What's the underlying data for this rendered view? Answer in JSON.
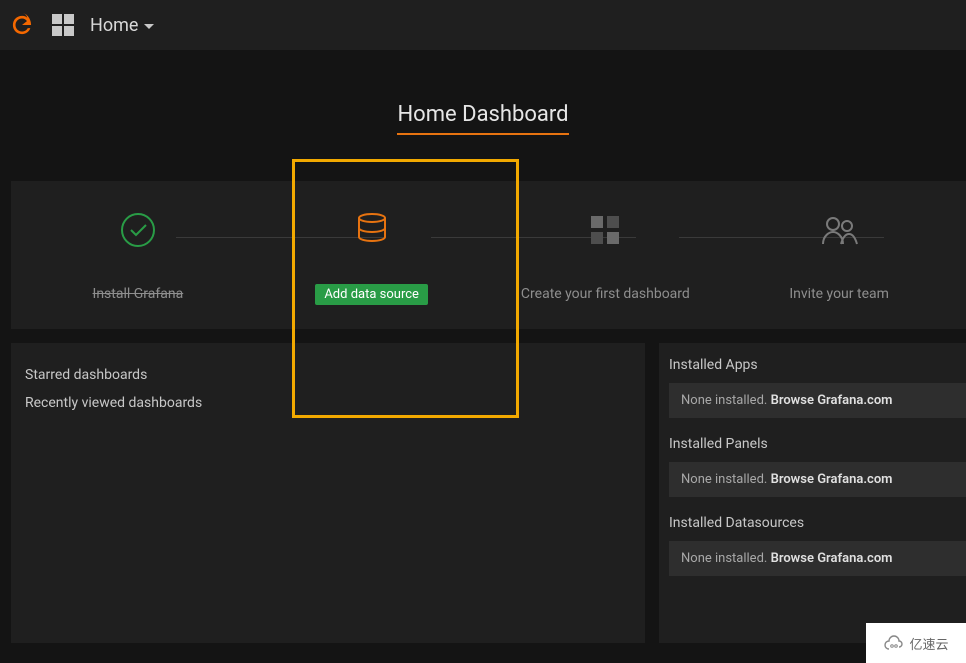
{
  "nav": {
    "breadcrumb": "Home"
  },
  "title": "Home Dashboard",
  "colors": {
    "accent": "#e77310",
    "success": "#299c46"
  },
  "getting_started": {
    "steps": [
      {
        "label": "Install Grafana",
        "state": "done",
        "icon": "check-circle"
      },
      {
        "label": "Add data source",
        "state": "active",
        "icon": "database"
      },
      {
        "label": "Create your first dashboard",
        "state": "pending",
        "icon": "dashboard-grid"
      },
      {
        "label": "Invite your team",
        "state": "pending",
        "icon": "users"
      }
    ]
  },
  "left_panel": {
    "rows": [
      "Starred dashboards",
      "Recently viewed dashboards"
    ]
  },
  "installed": {
    "sections": [
      {
        "title": "Installed Apps",
        "none_text": "None installed.",
        "link_text": "Browse Grafana.com"
      },
      {
        "title": "Installed Panels",
        "none_text": "None installed.",
        "link_text": "Browse Grafana.com"
      },
      {
        "title": "Installed Datasources",
        "none_text": "None installed.",
        "link_text": "Browse Grafana.com"
      }
    ]
  },
  "watermark": "亿速云"
}
